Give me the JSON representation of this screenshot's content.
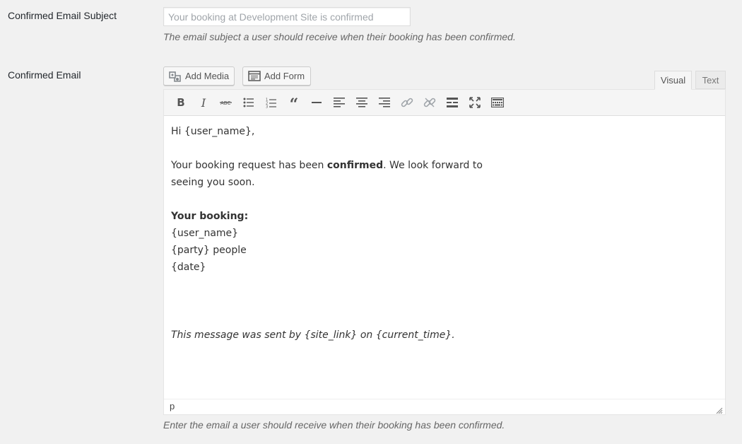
{
  "subject_row": {
    "label": "Confirmed Email Subject",
    "input_value": "",
    "input_placeholder": "Your booking at Development Site is confirmed",
    "description": "The email subject a user should receive when their booking has been confirmed."
  },
  "email_row": {
    "label": "Confirmed Email",
    "add_media_label": "Add Media",
    "add_form_label": "Add Form",
    "tabs": [
      {
        "label": "Visual",
        "active": true
      },
      {
        "label": "Text",
        "active": false
      }
    ],
    "toolbar": [
      "bold-icon",
      "italic-icon",
      "strikethrough-icon",
      "bulleted-list-icon",
      "numbered-list-icon",
      "blockquote-icon",
      "horizontal-line-icon",
      "align-left-icon",
      "align-center-icon",
      "align-right-icon",
      "insert-link-icon",
      "remove-link-icon",
      "read-more-icon",
      "fullscreen-icon",
      "toolbar-toggle-icon"
    ],
    "body": {
      "greeting": "Hi {user_name},",
      "para_pre": "Your booking request has been ",
      "para_bold": "confirmed",
      "para_post_line1": ". We look forward to",
      "para_line2": "seeing you soon.",
      "booking_heading": "Your booking:",
      "booking_name": "{user_name}",
      "booking_party": "{party} people",
      "booking_date": "{date}",
      "footer": "This message was sent by {site_link} on {current_time}."
    },
    "status_path": "p",
    "description": "Enter the email a user should receive when their booking has been confirmed."
  }
}
